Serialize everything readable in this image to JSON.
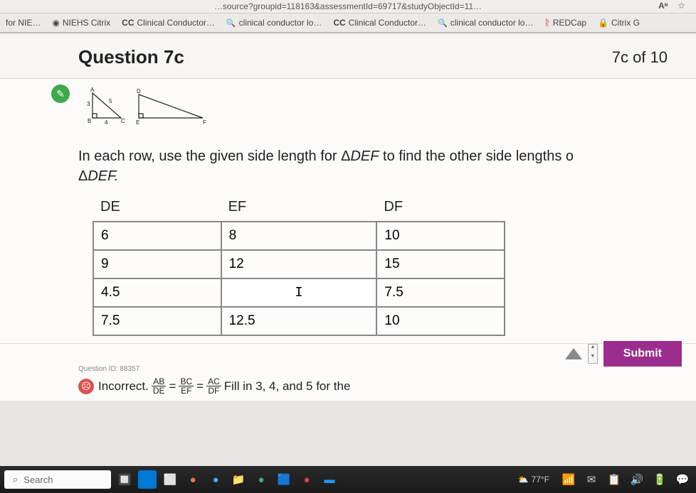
{
  "url_fragment": "…source?groupid=118163&assessmentId=69717&studyObjectId=11…",
  "url_icon_a": "Aᶰ",
  "bookmarks": {
    "item0": "for NIE…",
    "item1": "NIEHS Citrix",
    "item2_prefix": "CC",
    "item2": "Clinical Conductor…",
    "item3": "clinical conductor lo…",
    "item4_prefix": "CC",
    "item4": "Clinical Conductor…",
    "item5": "clinical conductor lo…",
    "item6": "REDCap",
    "item7": "Citrix G"
  },
  "question": {
    "title": "Question 7c",
    "counter": "7c of 10",
    "prompt_part1": "In each row, use the given side length for Δ",
    "prompt_tri1": "DEF",
    "prompt_part2": " to find the other side lengths o",
    "prompt_line2_pre": "Δ",
    "prompt_line2": "DEF."
  },
  "table": {
    "headers": {
      "c1": "DE",
      "c2": "EF",
      "c3": "DF"
    },
    "rows": [
      {
        "de": "6",
        "ef": "8",
        "df": "10"
      },
      {
        "de": "9",
        "ef": "12",
        "df": "15"
      },
      {
        "de": "4.5",
        "ef": "I",
        "df": "7.5"
      },
      {
        "de": "7.5",
        "ef": "12.5",
        "df": "10"
      }
    ]
  },
  "question_id": "Question ID: 88357",
  "feedback": {
    "label": "Incorrect.",
    "frac1_top": "AB",
    "frac1_bot": "DE",
    "eq": "=",
    "frac2_top": "BC",
    "frac2_bot": "EF",
    "frac3_top": "AC",
    "frac3_bot": "DF",
    "tail": "Fill in 3, 4, and 5 for the"
  },
  "submit_label": "Submit",
  "taskbar": {
    "search_placeholder": "Search",
    "temp": "77°F"
  },
  "tri_labels": {
    "A": "A",
    "B": "B",
    "C": "C",
    "D": "D",
    "E": "E",
    "F": "F",
    "s3": "3",
    "s4": "4",
    "s5": "5"
  }
}
